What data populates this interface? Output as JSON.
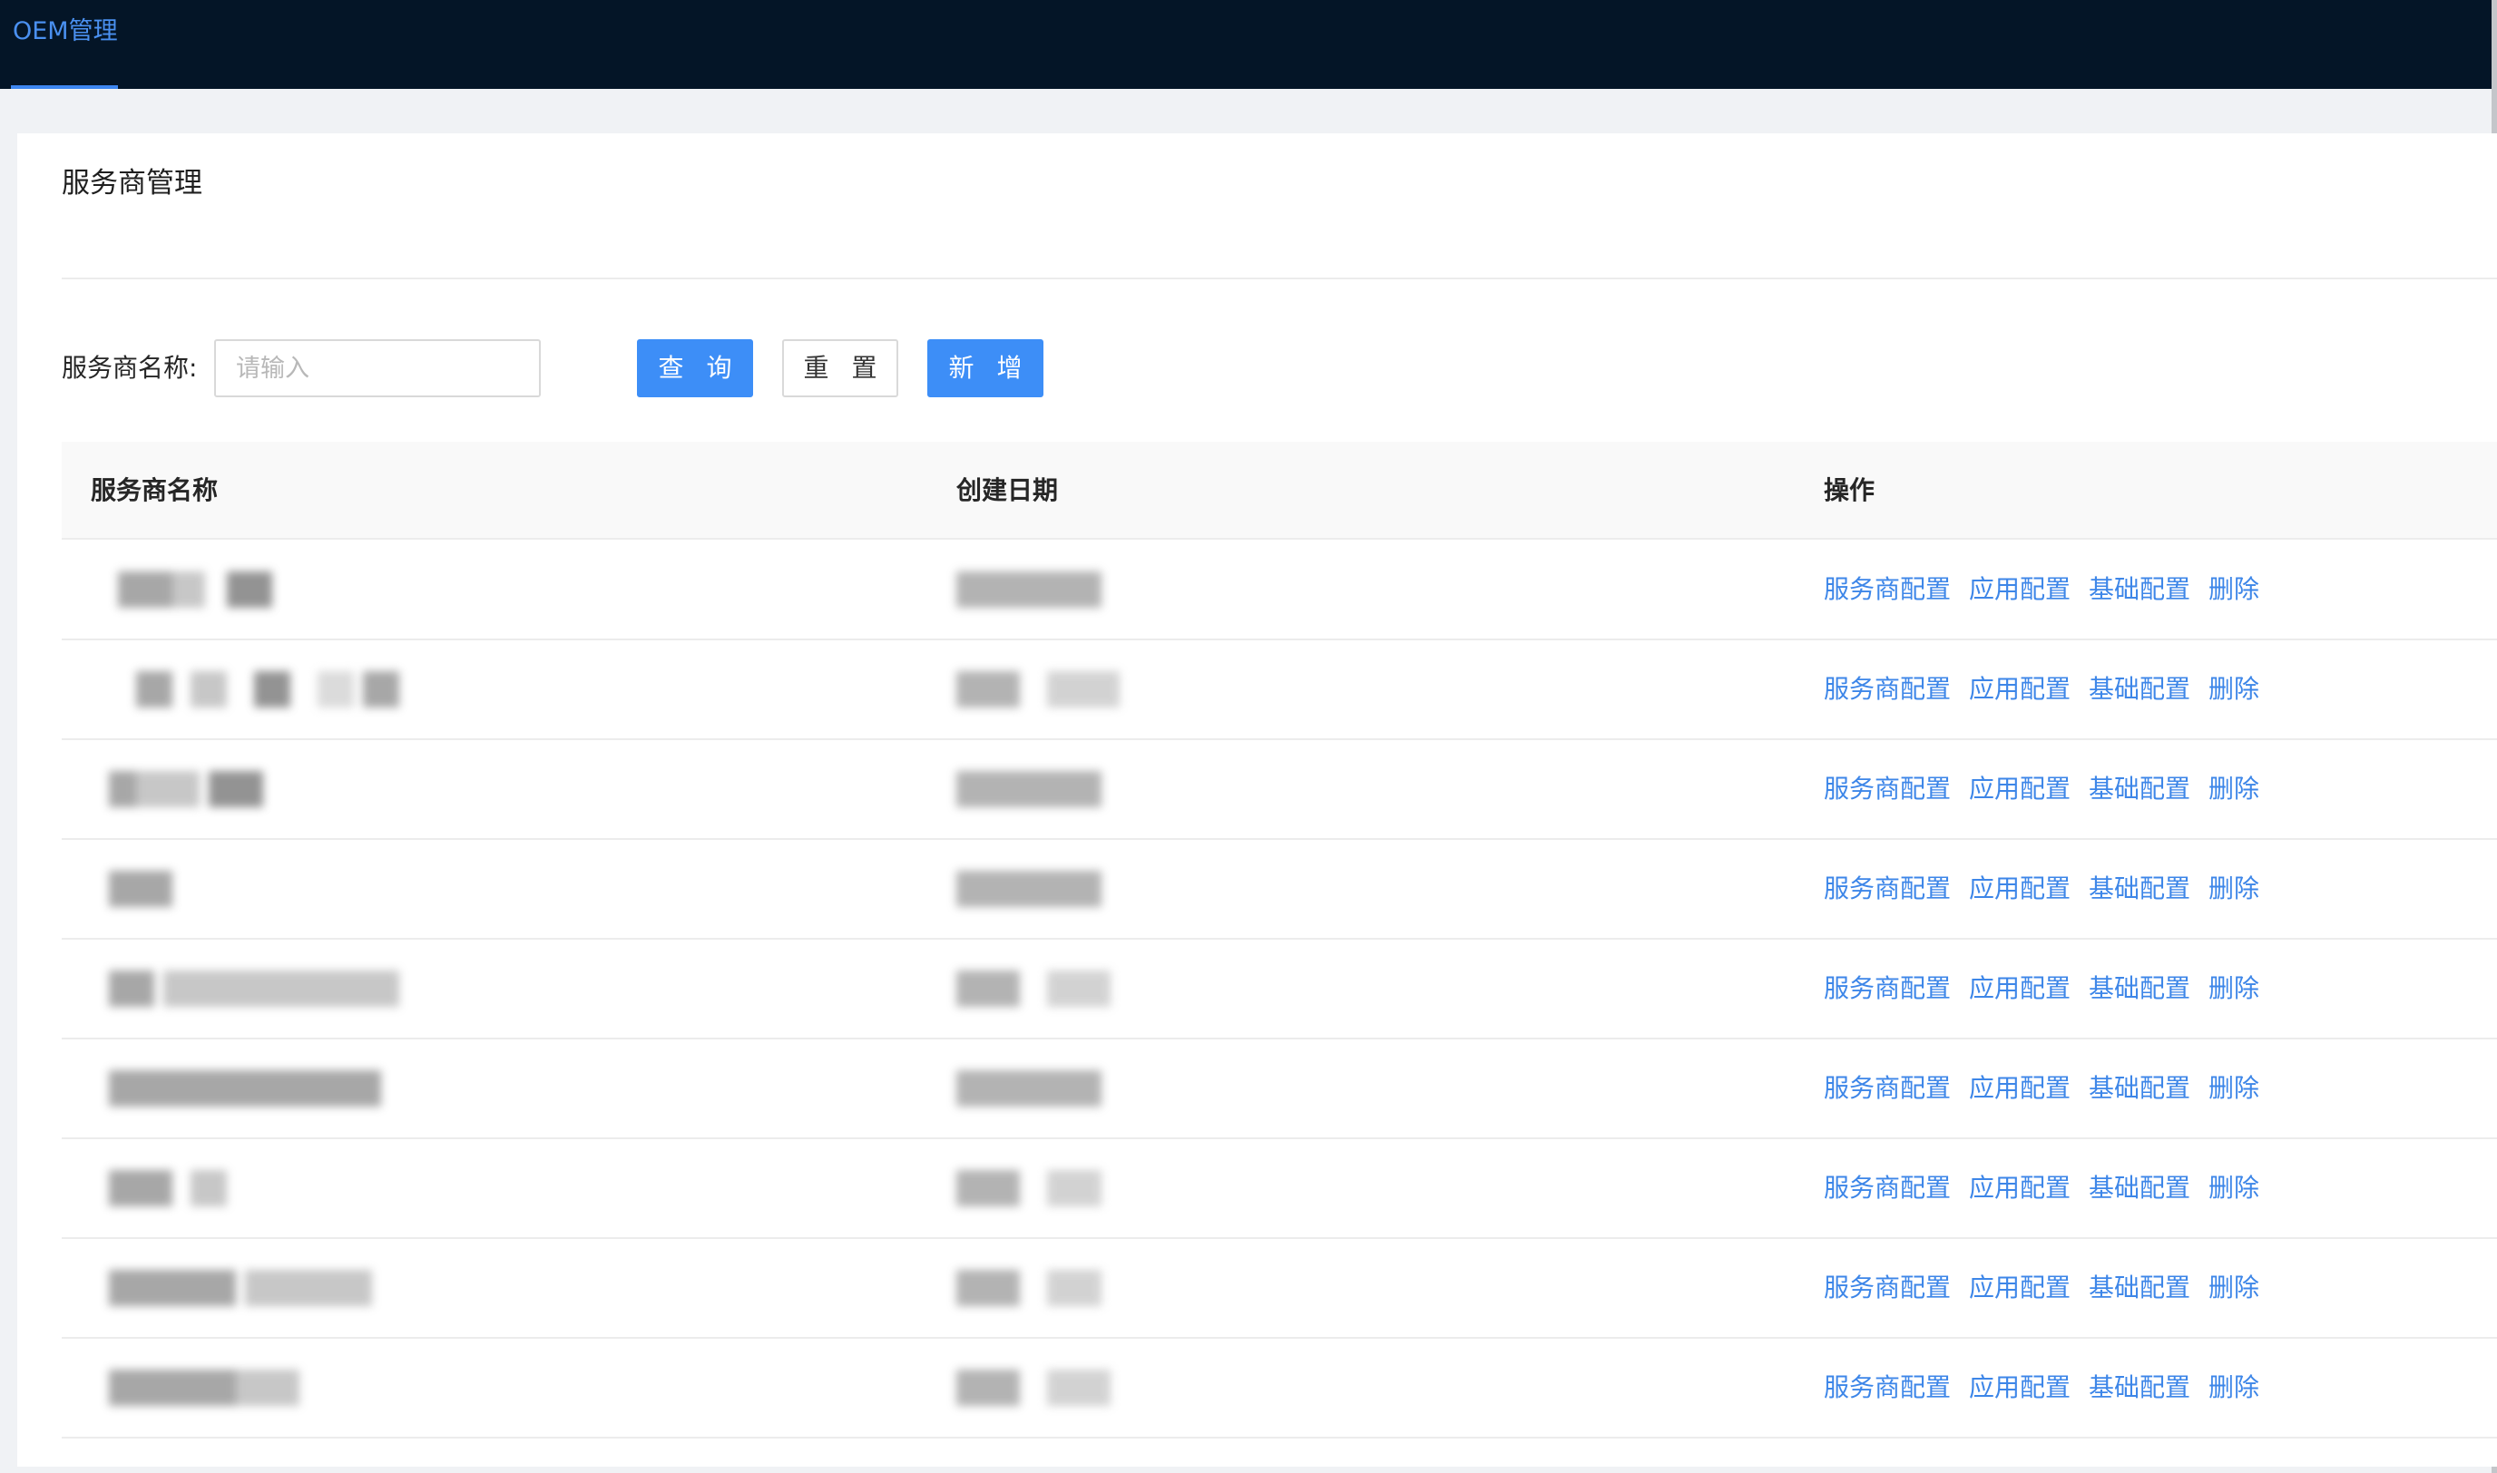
{
  "nav": {
    "active_tab": "OEM管理"
  },
  "page": {
    "title": "服务商管理"
  },
  "filter": {
    "label": "服务商名称:",
    "placeholder": "请输入",
    "value": "",
    "query_label": "查 询",
    "reset_label": "重 置",
    "add_label": "新 增"
  },
  "table": {
    "columns": [
      "服务商名称",
      "创建日期",
      "操作"
    ],
    "actions": [
      "服务商配置",
      "应用配置",
      "基础配置",
      "删除"
    ],
    "rows": [
      {
        "name": "",
        "date": ""
      },
      {
        "name": "",
        "date": ""
      },
      {
        "name": "",
        "date": ""
      },
      {
        "name": "",
        "date": ""
      },
      {
        "name": "",
        "date": ""
      },
      {
        "name": "",
        "date": ""
      },
      {
        "name": "",
        "date": ""
      },
      {
        "name": "",
        "date": ""
      },
      {
        "name": "",
        "date": ""
      }
    ]
  },
  "colors": {
    "topbar": "#041527",
    "accent": "#3d86f0",
    "link": "#3d86e8",
    "page_bg": "#f0f2f5"
  }
}
